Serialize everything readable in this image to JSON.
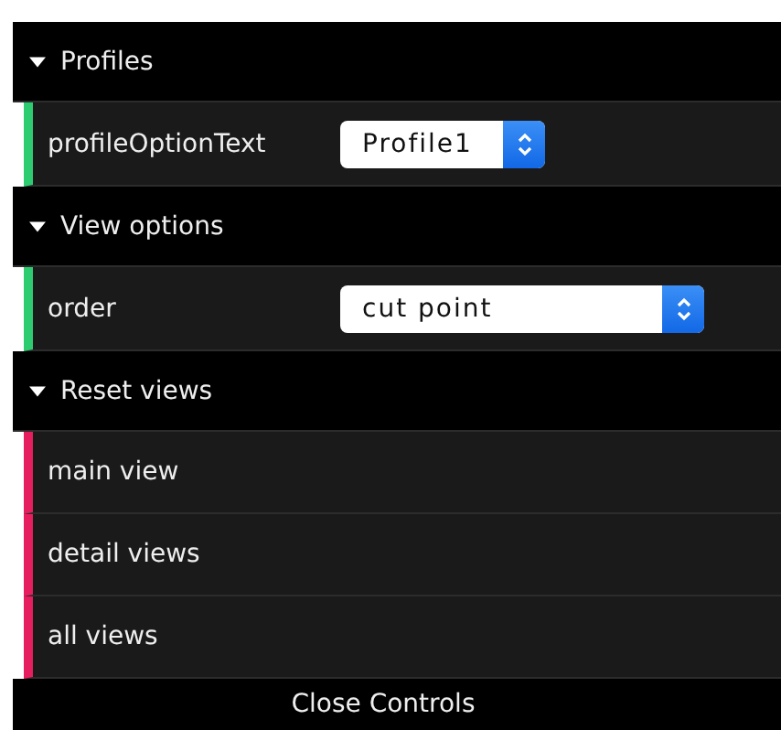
{
  "folders": [
    {
      "title": "Profiles",
      "expanded": true,
      "controls": [
        {
          "kind": "select",
          "label": "profileOptionText",
          "value": "Profile1"
        }
      ]
    },
    {
      "title": "View options",
      "expanded": true,
      "controls": [
        {
          "kind": "select",
          "label": "order",
          "value": "cut point"
        }
      ]
    },
    {
      "title": "Reset views",
      "expanded": true,
      "controls": [
        {
          "kind": "button",
          "label": "main view"
        },
        {
          "kind": "button",
          "label": "detail views"
        },
        {
          "kind": "button",
          "label": "all views"
        }
      ]
    }
  ],
  "close_button": "Close Controls"
}
